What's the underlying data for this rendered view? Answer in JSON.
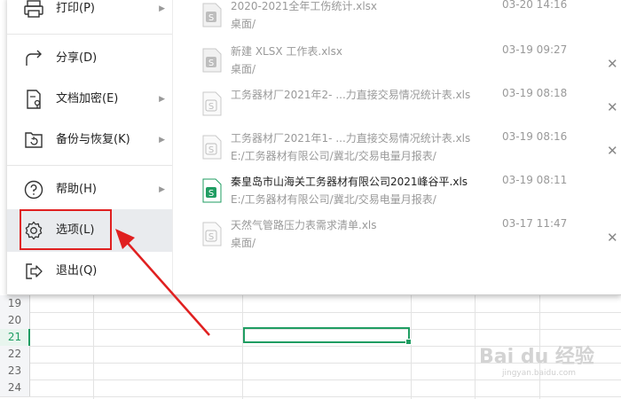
{
  "sheet": {
    "rows": [
      "19",
      "20",
      "21",
      "22",
      "23",
      "24"
    ],
    "active_row": "21"
  },
  "menu": {
    "items": [
      {
        "label": "打印(P)",
        "icon": "printer-icon",
        "has_submenu": true
      },
      {
        "label": "分享(D)",
        "icon": "share-icon",
        "has_submenu": false
      },
      {
        "label": "文档加密(E)",
        "icon": "document-lock-icon",
        "has_submenu": true
      },
      {
        "label": "备份与恢复(K)",
        "icon": "backup-restore-icon",
        "has_submenu": true
      },
      {
        "label": "帮助(H)",
        "icon": "help-icon",
        "has_submenu": true
      },
      {
        "label": "选项(L)",
        "icon": "gear-icon",
        "has_submenu": false
      },
      {
        "label": "退出(Q)",
        "icon": "exit-icon",
        "has_submenu": false
      }
    ],
    "highlighted": "选项(L)"
  },
  "recent_files": [
    {
      "name": "2020-2021全年工伤统计.xlsx",
      "path": "桌面/",
      "date": "03-20 14:16",
      "icon": "spreadsheet-file-gray-icon",
      "closable": false
    },
    {
      "name": "新建 XLSX 工作表.xlsx",
      "path": "桌面/",
      "date": "03-19 09:27",
      "icon": "spreadsheet-file-gray-icon",
      "closable": true
    },
    {
      "name": "工务器材厂2021年2-   ...力直接交易情况统计表.xls",
      "path": "",
      "date": "03-19 08:18",
      "icon": "spreadsheet-file-outline-icon",
      "closable": true
    },
    {
      "name": "工务器材厂2021年1-   ...力直接交易情况统计表.xls",
      "path": "E:/工务器材有限公司/冀北/交易电量月报表/",
      "date": "03-19 08:16",
      "icon": "spreadsheet-file-outline-icon",
      "closable": true
    },
    {
      "name": "秦皇岛市山海关工务器材有限公司2021峰谷平.xls",
      "path": "E:/工务器材有限公司/冀北/交易电量月报表/",
      "date": "03-19 08:11",
      "icon": "spreadsheet-file-green-icon",
      "closable": false
    },
    {
      "name": "天然气管路压力表需求清单.xls",
      "path": "桌面/",
      "date": "03-17 11:47",
      "icon": "spreadsheet-file-outline-icon",
      "closable": true
    }
  ],
  "close_glyph": "✕",
  "submenu_glyph": "▶",
  "watermark": {
    "logo": "Bai du 经验",
    "url": "jingyan.baidu.com"
  },
  "colors": {
    "accent": "#1f9d62",
    "annotation": "#e02020"
  }
}
